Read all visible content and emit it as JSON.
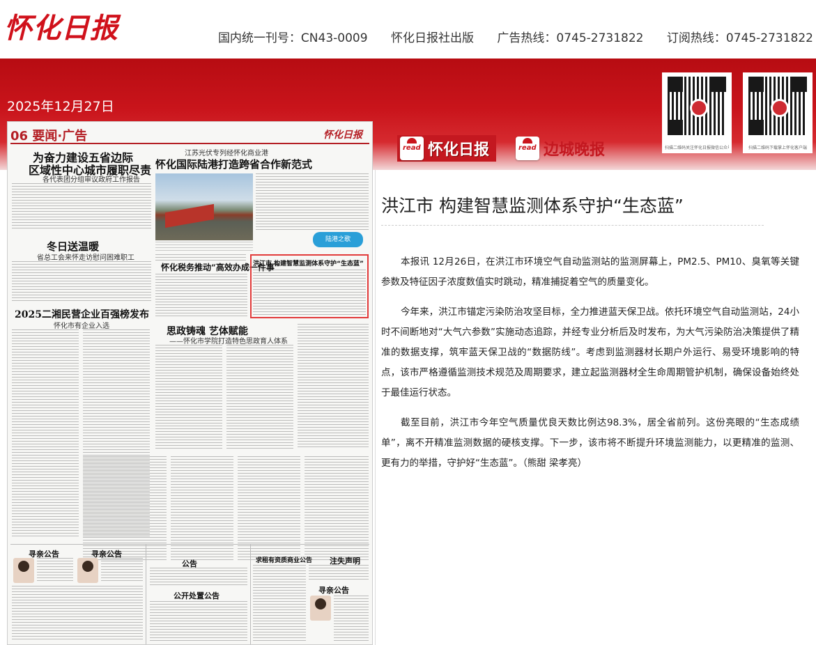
{
  "header": {
    "logo": "怀化日报",
    "issn": "国内统一刊号：CN43-0009",
    "publisher": "怀化日报社出版",
    "ad_hotline": "广告热线：0745-2731822",
    "sub_hotline": "订阅热线：0745-2731822"
  },
  "date": "2025年12月27日",
  "qr_codes": [
    {
      "caption": "扫描二维码关注怀化日报微信公众号",
      "icon": "qr-code-icon"
    },
    {
      "caption": "扫描二维码下载掌上怀化客户端",
      "icon": "qr-code-icon"
    }
  ],
  "brands": [
    {
      "tag": "read",
      "name": "怀化日报"
    },
    {
      "tag": "read",
      "name": "边城晚报"
    }
  ],
  "paper_page": {
    "section": "06 要闻·广告",
    "masthead": "怀化日报",
    "headlines": [
      "为奋力建设五省边际",
      "区域性中心城市履职尽责",
      "江苏光伏专列经怀化商业港",
      "怀化国际陆港打造跨省合作新范式",
      "冬日送温暖",
      "怀化税务推动“高效办成一件事”",
      "2025二湘民营企业百强榜发布",
      "思政铸魂 艺体赋能"
    ],
    "subheads": [
      "各代表团分组审议政府工作报告",
      "省总工会来怀走访慰问困难职工",
      "怀化市有企业入选",
      "——怀化市学院打造特色思政育人体系"
    ],
    "highlight_title": "洪江市 构建智慧监测体系守护“生态蓝”",
    "badge": "陆港之歌",
    "notices": [
      "寻亲公告",
      "寻亲公告",
      "公告",
      "公开处置公告",
      "求租有资质商业公告",
      "注失声明",
      "寻亲公告"
    ]
  },
  "article": {
    "title": "洪江市 构建智慧监测体系守护“生态蓝”",
    "paragraphs": [
      "本报讯 12月26日，在洪江市环境空气自动监测站的监测屏幕上，PM2.5、PM10、臭氧等关键参数及特征因子浓度数值实时跳动，精准捕捉着空气的质量变化。",
      "今年来，洪江市锚定污染防治攻坚目标，全力推进蓝天保卫战。依托环境空气自动监测站，24小时不间断地对“大气六参数”实施动态追踪，并经专业分析后及时发布，为大气污染防治决策提供了精准的数据支撑，筑牢蓝天保卫战的“数据防线”。考虑到监测器材长期户外运行、易受环境影响的特点，该市严格遵循监测技术规范及周期要求，建立起监测器材全生命周期管护机制，确保设备始终处于最佳运行状态。",
      "截至目前，洪江市今年空气质量优良天数比例达98.3%，居全省前列。这份亮眼的“生态成绩单”，离不开精准监测数据的硬核支撑。下一步，该市将不断提升环境监测能力，以更精准的监测、更有力的举措，守护好“生态蓝”。（熊甜 梁孝亮）"
    ]
  }
}
